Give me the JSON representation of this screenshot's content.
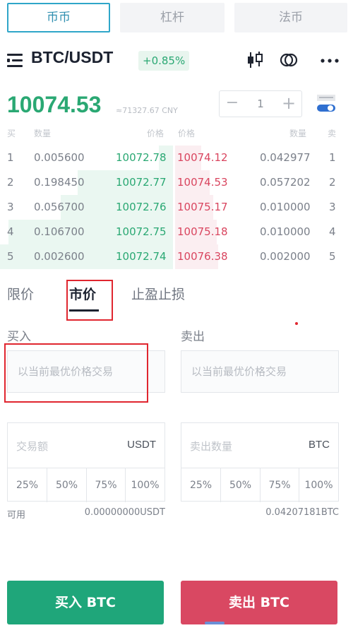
{
  "top_tabs": [
    {
      "label": "币币",
      "active": true
    },
    {
      "label": "杠杆",
      "active": false
    },
    {
      "label": "法币",
      "active": false
    }
  ],
  "header": {
    "pair": "BTC/USDT",
    "change": "+0.85%"
  },
  "price": {
    "last": "10074.53",
    "cny": "≈71327.67 CNY"
  },
  "stepper": {
    "minus": "−",
    "value": "1",
    "plus": "+"
  },
  "orderbook": {
    "headers": {
      "buy": "买",
      "amount_left": "数量",
      "price_left": "价格",
      "price_right": "价格",
      "amount_right": "数量",
      "sell": "卖"
    },
    "rows": [
      {
        "idx": "1",
        "bid_amt": "0.005600",
        "bid": "10072.78",
        "ask": "10074.12",
        "ask_amt": "0.042977",
        "idx_r": "1",
        "bid_depth": 0.08,
        "ask_depth": 0.15
      },
      {
        "idx": "2",
        "bid_amt": "0.198450",
        "bid": "10072.77",
        "ask": "10074.53",
        "ask_amt": "0.057202",
        "idx_r": "2",
        "bid_depth": 0.55,
        "ask_depth": 0.2
      },
      {
        "idx": "3",
        "bid_amt": "0.056700",
        "bid": "10072.76",
        "ask": "10075.17",
        "ask_amt": "0.010000",
        "idx_r": "3",
        "bid_depth": 0.65,
        "ask_depth": 0.22
      },
      {
        "idx": "4",
        "bid_amt": "0.106700",
        "bid": "10072.75",
        "ask": "10075.18",
        "ask_amt": "0.010000",
        "idx_r": "4",
        "bid_depth": 0.95,
        "ask_depth": 0.24
      },
      {
        "idx": "5",
        "bid_amt": "0.002600",
        "bid": "10072.74",
        "ask": "10076.38",
        "ask_amt": "0.002000",
        "idx_r": "5",
        "bid_depth": 1.0,
        "ask_depth": 0.25
      }
    ]
  },
  "order_types": [
    {
      "label": "限价",
      "active": false
    },
    {
      "label": "市价",
      "active": true
    },
    {
      "label": "止盈止损",
      "active": false
    }
  ],
  "buy": {
    "label": "买入",
    "price_placeholder": "以当前最优价格交易",
    "amount_placeholder": "交易额",
    "unit": "USDT",
    "percents": [
      "25%",
      "50%",
      "75%",
      "100%"
    ],
    "avail_label": "可用",
    "avail_value": "0.00000000USDT",
    "button": "买入 BTC"
  },
  "sell": {
    "label": "卖出",
    "price_placeholder": "以当前最优价格交易",
    "amount_placeholder": "卖出数量",
    "unit": "BTC",
    "percents": [
      "25%",
      "50%",
      "75%",
      "100%"
    ],
    "avail_value": "0.04207181BTC",
    "button": "卖出 BTC"
  },
  "colors": {
    "green": "#2aa873",
    "red": "#d9455f",
    "buy_button": "#1fa67a",
    "sell_button": "#d94862",
    "highlight_box": "#e0262f",
    "tab_border": "#2fa6c9"
  }
}
